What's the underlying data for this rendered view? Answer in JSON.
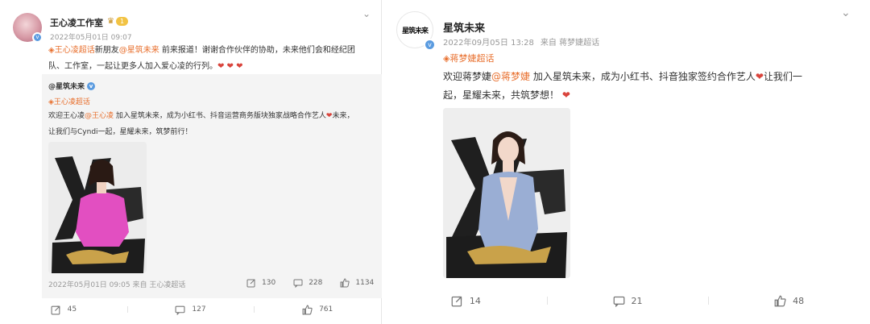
{
  "left": {
    "account_name": "王心凌工作室",
    "level_badge": "1",
    "timestamp": "2022年05月01日 09:07",
    "text_prefix": "王心凌超话",
    "text_mid1": "新朋友",
    "mention": "@星筑未来",
    "text_line1_rest": " 前来报道！谢谢合作伙伴的协助，未来他们会和经纪团",
    "text_line2": "队、工作室，一起让更多人加入爱心凌的行列。",
    "hearts": "❤ ❤ ❤",
    "retweet": {
      "author": "@星筑未来",
      "supertopic": "王心凌超话",
      "line1_a": "欢迎王心凌",
      "line1_mention": "@王心凌",
      "line1_b": " 加入星筑未来，成为小红书、抖音运营商务版块独家战略合作艺人",
      "line1_c": "未来，",
      "line2": "让我们与Cyndi一起，星耀未来，筑梦前行！",
      "meta": "2022年05月01日 09:05 来自 王心凌超话",
      "reposts": "130",
      "comments": "228",
      "likes": "1134"
    },
    "footer": {
      "reposts": "45",
      "comments": "127",
      "likes": "761"
    }
  },
  "right": {
    "account_name": "星筑未来",
    "avatar_text": "星筑未来",
    "timestamp": "2022年09月05日 13:28",
    "source": "来自 蒋梦婕超话",
    "supertopic": "蒋梦婕超话",
    "line1_a": "欢迎蒋梦婕",
    "line1_mention": "@蒋梦婕",
    "line1_b": " 加入星筑未来，成为小红书、抖音独家签约合作艺人",
    "line1_c": "让我们一",
    "line2": "起，星耀未来，共筑梦想！",
    "footer": {
      "reposts": "14",
      "comments": "21",
      "likes": "48"
    }
  },
  "colors": {
    "accent": "#e86f2d",
    "heart": "#d9443c",
    "verified": "#5a9be0"
  }
}
